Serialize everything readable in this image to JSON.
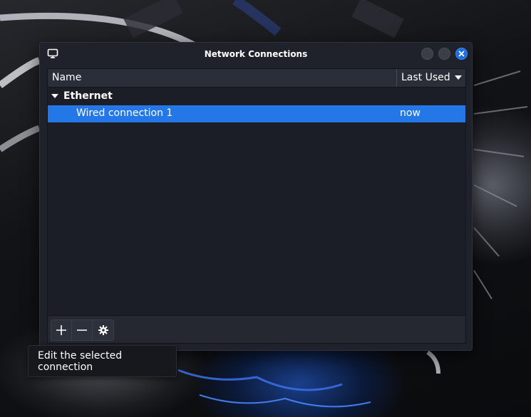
{
  "window": {
    "title": "Network Connections",
    "app_icon": "monitor-icon",
    "controls": [
      "minimize-icon",
      "maximize-icon",
      "close-icon"
    ]
  },
  "table": {
    "columns": {
      "name": "Name",
      "last_used": "Last Used"
    },
    "groups": [
      {
        "label": "Ethernet",
        "expanded": true,
        "connections": [
          {
            "name": "Wired connection 1",
            "last_used": "now",
            "selected": true
          }
        ]
      }
    ]
  },
  "toolbar": {
    "buttons": [
      "add-icon",
      "remove-icon",
      "gear-icon"
    ]
  },
  "tooltip": {
    "text": "Edit the selected connection"
  },
  "colors": {
    "selection": "#2377e6",
    "close_button": "#1b6ee0",
    "window_bg": "#1f222b"
  }
}
